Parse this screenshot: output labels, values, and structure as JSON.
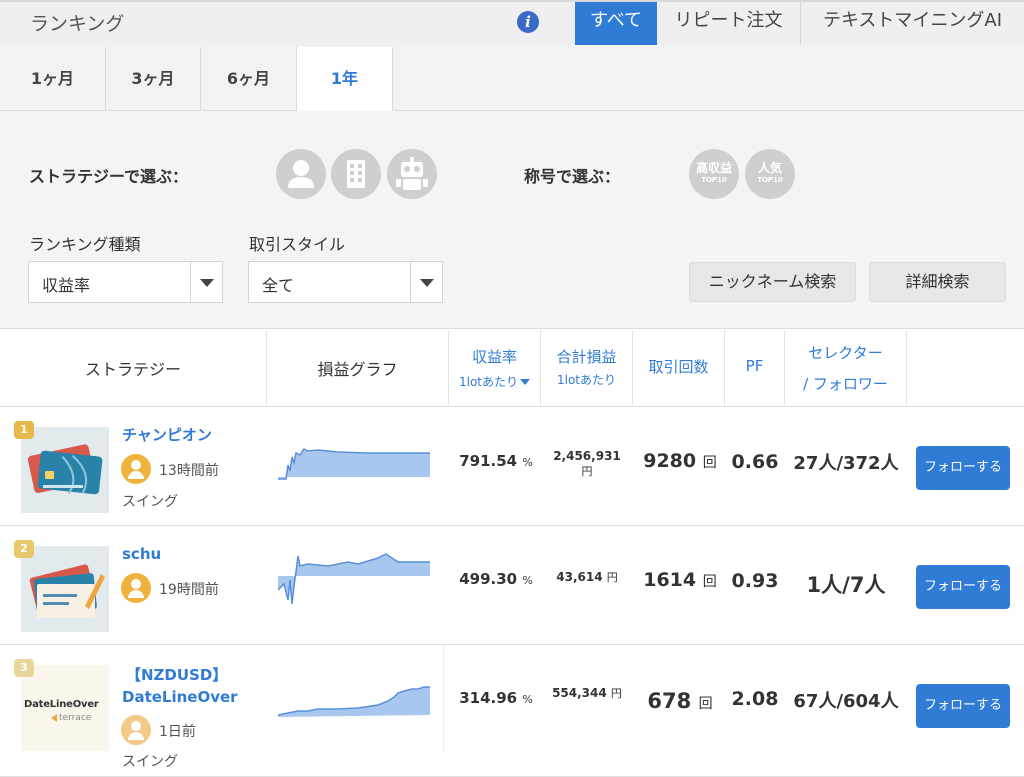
{
  "header": {
    "title": "ランキング",
    "tabs": [
      {
        "label": "すべて",
        "active": true
      },
      {
        "label": "リピート注文",
        "active": false
      },
      {
        "label": "テキストマイニングAI",
        "active": false
      }
    ]
  },
  "periods": [
    {
      "label": "1ヶ月",
      "active": false
    },
    {
      "label": "3ヶ月",
      "active": false
    },
    {
      "label": "6ヶ月",
      "active": false
    },
    {
      "label": "1年",
      "active": true
    }
  ],
  "filters": {
    "strategy_label": "ストラテジーで選ぶ：",
    "strategy_icons": [
      "person-icon",
      "building-icon",
      "robot-icon"
    ],
    "title_label": "称号で選ぶ：",
    "title_badges": [
      {
        "main": "高収益",
        "sub": "TOP10"
      },
      {
        "main": "人気",
        "sub": "TOP10"
      }
    ],
    "ranking_type_label": "ランキング種類",
    "ranking_type_value": "収益率",
    "trade_style_label": "取引スタイル",
    "trade_style_value": "全て",
    "nickname_search": "ニックネーム検索",
    "detail_search": "詳細検索"
  },
  "table": {
    "headers": {
      "strategy": "ストラテジー",
      "graph": "損益グラフ",
      "rate": "収益率",
      "rate_sub": "1lotあたり",
      "profit": "合計損益",
      "profit_sub": "1lotあたり",
      "trades": "取引回数",
      "pf": "PF",
      "selector": "セレクター",
      "follower": "/ フォロワー"
    },
    "rows": [
      {
        "rank": "1",
        "name": "チャンピオン",
        "name2": "",
        "time": "13時間前",
        "style": "スイング",
        "rate": "791.54",
        "rate_unit": "%",
        "profit": "2,456,931",
        "profit_unit": "円",
        "trades": "9280",
        "trades_unit": "回",
        "pf": "0.66",
        "selector_follower": "27人/372人",
        "follow": "フォローする"
      },
      {
        "rank": "2",
        "name": "schu",
        "name2": "",
        "time": "19時間前",
        "style": "",
        "rate": "499.30",
        "rate_unit": "%",
        "profit": "43,614",
        "profit_unit": "円",
        "trades": "1614",
        "trades_unit": "回",
        "pf": "0.93",
        "selector_follower": "1人/7人",
        "follow": "フォローする"
      },
      {
        "rank": "3",
        "name": "【NZDUSD】",
        "name2": "DateLineOver",
        "time": "1日前",
        "style": "スイング",
        "rate": "314.96",
        "rate_unit": "%",
        "profit": "554,344",
        "profit_unit": "円",
        "trades": "678",
        "trades_unit": "回",
        "pf": "2.08",
        "selector_follower": "67人/604人",
        "follow": "フォローする"
      }
    ],
    "thumb_text": {
      "brand": "DateLineOver",
      "sub": "terrace"
    }
  },
  "colors": {
    "accent": "#2f7bd6",
    "rank_gold": "#e8b84b",
    "graph_fill": "#a9c7ee",
    "graph_line": "#5b8fdc"
  }
}
